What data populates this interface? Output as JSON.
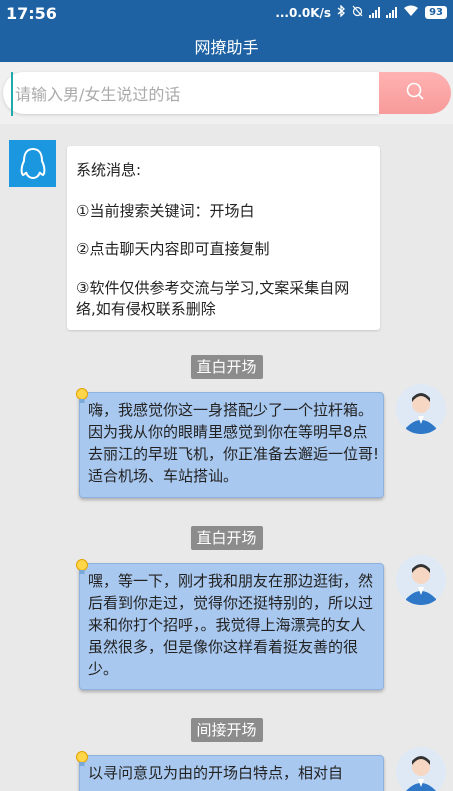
{
  "status_bar": {
    "time": "17:56",
    "network_speed": "...0.0K/s",
    "battery": "93"
  },
  "app_bar": {
    "title": "网撩助手"
  },
  "search": {
    "placeholder": "请输入男/女生说过的话",
    "value": ""
  },
  "system_message": {
    "heading": "系统消息:",
    "lines": [
      "①当前搜索关键词：开场白",
      "②点击聊天内容即可直接复制",
      "③软件仅供参考交流与学习,文案采集自网络,如有侵权联系删除"
    ]
  },
  "messages": [
    {
      "tag": "直白开场",
      "text": "嗨，我感觉你这一身搭配少了一个拉杆箱。因为我从你的眼睛里感觉到你在等明早8点去丽江的早班飞机，你正准备去邂逅一位哥!适合机场、车站搭讪。"
    },
    {
      "tag": "直白开场",
      "text": "嘿，等一下，刚才我和朋友在那边逛街，然后看到你走过，觉得你还挺特别的，所以过来和你打个招呼，。我觉得上海漂亮的女人虽然很多，但是像你这样看着挺友善的很少。"
    },
    {
      "tag": "间接开场",
      "text": "以寻问意见为由的开场白特点，相对自"
    }
  ],
  "colors": {
    "primary": "#1e62a3",
    "bubble": "#a9c8ef",
    "tag": "#8c8c8c",
    "search_button": "#f79a9a"
  },
  "icons": {
    "search": "search-icon",
    "system_avatar": "penguin-icon",
    "user_avatar": "user-avatar-icon",
    "bubble_badge": "lightbulb-icon"
  }
}
